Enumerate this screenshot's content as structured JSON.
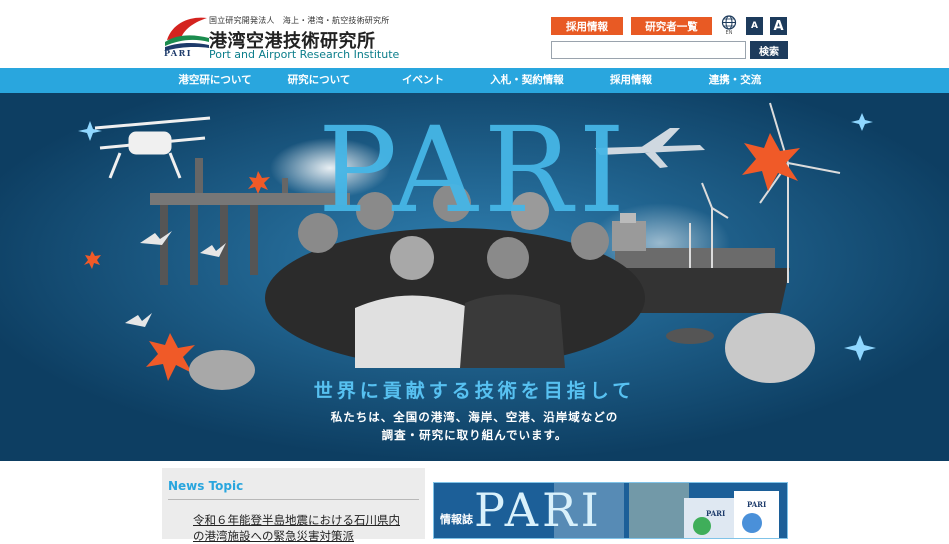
{
  "header": {
    "org_sub": "国立研究開発法人　海上・港湾・航空技術研究所",
    "org_name_ja": "港湾空港技術研究所",
    "org_name_en": "Port and Airport Research Institute",
    "logo_text": "PARI",
    "btn_recruit": "採用情報",
    "btn_researchers": "研究者一覧",
    "lang_label": "EN",
    "font_small": "A",
    "font_large": "A",
    "search_value": "",
    "search_btn": "検索"
  },
  "nav": {
    "items": [
      {
        "label": "港空研について"
      },
      {
        "label": "研究について"
      },
      {
        "label": "イベント"
      },
      {
        "label": "入札・契約情報"
      },
      {
        "label": "採用情報"
      },
      {
        "label": "連携・交流"
      }
    ]
  },
  "hero": {
    "title": "PARI",
    "tagline": "世界に貢献する技術を目指して",
    "desc_line1": "私たちは、全国の港湾、海岸、空港、沿岸域などの",
    "desc_line2": "調査・研究に取り組んでいます。"
  },
  "news": {
    "title": "News Topic",
    "item1": "令和６年能登半島地震における石川県内の港湾施設への緊急災害対策派"
  },
  "banner": {
    "label": "情報誌",
    "title": "PARI",
    "booklet_label": "PARI"
  },
  "colors": {
    "accent_orange": "#e85a24",
    "nav_blue": "#29a6de",
    "dark_navy": "#1d3b5c",
    "hero_bg": "#0d3e62"
  }
}
